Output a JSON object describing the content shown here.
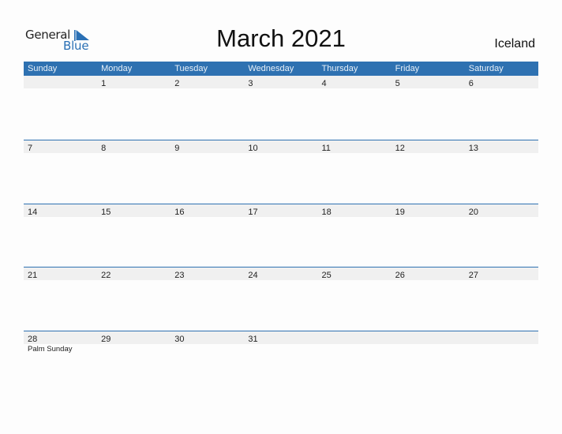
{
  "logo": {
    "line1": "General",
    "line2": "Blue",
    "mark_icon": "blue-triangle-flag",
    "brand_color": "#2a70b5"
  },
  "title": "March 2021",
  "country": "Iceland",
  "colors": {
    "header_bg": "#2e71b1",
    "header_text": "#e8f0f8",
    "daybar_bg": "#f0f0f0",
    "separator": "#2e71b1"
  },
  "weekdays": [
    "Sunday",
    "Monday",
    "Tuesday",
    "Wednesday",
    "Thursday",
    "Friday",
    "Saturday"
  ],
  "weeks": [
    {
      "days": [
        "",
        "1",
        "2",
        "3",
        "4",
        "5",
        "6"
      ],
      "events": [
        "",
        "",
        "",
        "",
        "",
        "",
        ""
      ]
    },
    {
      "days": [
        "7",
        "8",
        "9",
        "10",
        "11",
        "12",
        "13"
      ],
      "events": [
        "",
        "",
        "",
        "",
        "",
        "",
        ""
      ]
    },
    {
      "days": [
        "14",
        "15",
        "16",
        "17",
        "18",
        "19",
        "20"
      ],
      "events": [
        "",
        "",
        "",
        "",
        "",
        "",
        ""
      ]
    },
    {
      "days": [
        "21",
        "22",
        "23",
        "24",
        "25",
        "26",
        "27"
      ],
      "events": [
        "",
        "",
        "",
        "",
        "",
        "",
        ""
      ]
    },
    {
      "days": [
        "28",
        "29",
        "30",
        "31",
        "",
        "",
        ""
      ],
      "events": [
        "Palm Sunday",
        "",
        "",
        "",
        "",
        "",
        ""
      ]
    }
  ]
}
